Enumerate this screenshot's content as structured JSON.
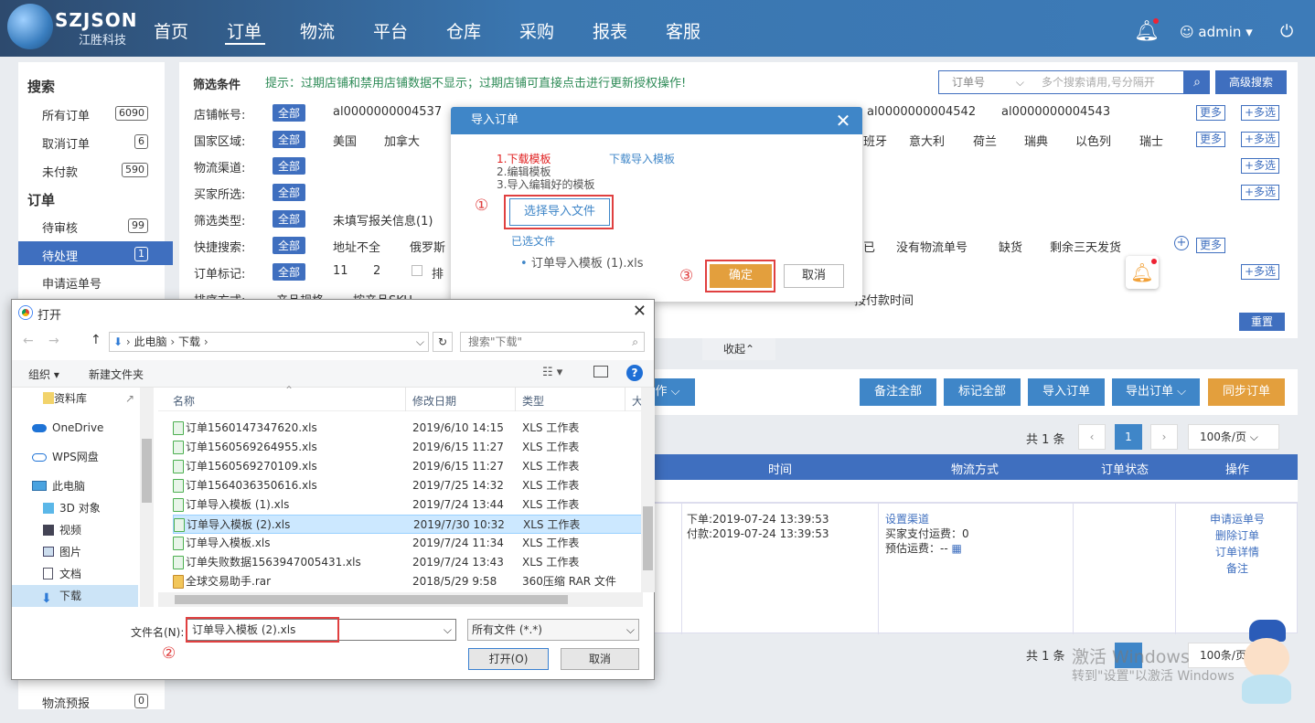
{
  "app": {
    "brand": "SZJSON",
    "brand_sub": "江胜科技",
    "user": "admin"
  },
  "nav": [
    "首页",
    "订单",
    "物流",
    "平台",
    "仓库",
    "采购",
    "报表",
    "客服"
  ],
  "sidebar": {
    "search_header": "搜索",
    "search_items": [
      {
        "label": "所有订单",
        "count": "6090"
      },
      {
        "label": "取消订单",
        "count": "6"
      },
      {
        "label": "未付款",
        "count": "590"
      }
    ],
    "order_header": "订单",
    "order_items": [
      {
        "label": "待审核",
        "count": "99"
      },
      {
        "label": "待处理",
        "count": "1"
      },
      {
        "label": "申请运单号",
        "count": ""
      }
    ],
    "bottom_item": {
      "label": "物流预报",
      "count": "0"
    }
  },
  "filter": {
    "title": "筛选条件",
    "hint": "提示：过期店铺和禁用店铺数据不显示；过期店铺可直接点击进行更新授权操作!",
    "search_select": "订单号",
    "search_placeholder": "多个搜索请用,号分隔开",
    "advanced": "高级搜索",
    "all": "全部",
    "more": "更多",
    "multi": "+多选",
    "rows": [
      {
        "label": "店铺帐号:",
        "values": [
          "al0000000004537",
          "al0000000004542",
          "al0000000004543"
        ]
      },
      {
        "label": "国家区域:",
        "values": [
          "美国",
          "加拿大",
          "班牙",
          "意大利",
          "荷兰",
          "瑞典",
          "以色列",
          "瑞士"
        ]
      },
      {
        "label": "物流渠道:",
        "values": []
      },
      {
        "label": "买家所选:",
        "values": []
      },
      {
        "label": "筛选类型:",
        "values": [
          "未填写报关信息(1)"
        ]
      },
      {
        "label": "快捷搜索:",
        "values": [
          "地址不全",
          "俄罗斯",
          "已",
          "没有物流单号",
          "缺货",
          "剩余三天发货"
        ]
      },
      {
        "label": "订单标记:",
        "values": [
          "11",
          "2",
          "排"
        ]
      },
      {
        "label": "排序方式:",
        "values": [
          "产品规格",
          "按产品SKU",
          "按付款时间"
        ]
      }
    ],
    "reset": "重置",
    "collapse": "收起"
  },
  "actions": [
    "作",
    "备注全部",
    "标记全部",
    "导入订单",
    "导出订单",
    "同步订单"
  ],
  "pager": {
    "total": "共 1 条",
    "page": "1",
    "size": "100条/页"
  },
  "table": {
    "headers": [
      "时间",
      "物流方式",
      "订单状态",
      "操作"
    ],
    "row": {
      "order_time": "下单:2019-07-24 13:39:53",
      "pay_time": "付款:2019-07-24 13:39:53",
      "logistics_link": "设置渠道",
      "buyer_fee": "买家支付运费：0",
      "est_fee": "预估运费：--",
      "ops": [
        "申请运单号",
        "删除订单",
        "订单详情",
        "备注"
      ]
    }
  },
  "watermark": {
    "line1": "激活 Windows",
    "line2": "转到\"设置\"以激活 Windows"
  },
  "import_dialog": {
    "title": "导入订单",
    "step1": "1.下载模板",
    "download_link": "下载导入模板",
    "step2": "2.编辑模板",
    "step3": "3.导入编辑好的模板",
    "choose": "选择导入文件",
    "selected_label": "已选文件",
    "selected_file": "订单导入模板 (1).xls",
    "ok": "确定",
    "cancel": "取消",
    "mark1": "①",
    "mark3": "③"
  },
  "file_dialog": {
    "title": "打开",
    "path": [
      "此电脑",
      "下载"
    ],
    "search_placeholder": "搜索\"下载\"",
    "organize": "组织",
    "new_folder": "新建文件夹",
    "nav": [
      "资料库",
      "OneDrive",
      "WPS网盘",
      "此电脑",
      "3D 对象",
      "视频",
      "图片",
      "文档",
      "下载"
    ],
    "columns": [
      "名称",
      "修改日期",
      "类型",
      "大"
    ],
    "files": [
      {
        "name": "订单1560147347620.xls",
        "date": "2019/6/10 14:15",
        "type": "XLS 工作表"
      },
      {
        "name": "订单1560569264955.xls",
        "date": "2019/6/15 11:27",
        "type": "XLS 工作表"
      },
      {
        "name": "订单1560569270109.xls",
        "date": "2019/6/15 11:27",
        "type": "XLS 工作表"
      },
      {
        "name": "订单1564036350616.xls",
        "date": "2019/7/25 14:32",
        "type": "XLS 工作表"
      },
      {
        "name": "订单导入模板 (1).xls",
        "date": "2019/7/24 13:44",
        "type": "XLS 工作表"
      },
      {
        "name": "订单导入模板 (2).xls",
        "date": "2019/7/30 10:32",
        "type": "XLS 工作表"
      },
      {
        "name": "订单导入模板.xls",
        "date": "2019/7/24 11:34",
        "type": "XLS 工作表"
      },
      {
        "name": "订单失败数据1563947005431.xls",
        "date": "2019/7/24 13:43",
        "type": "XLS 工作表"
      },
      {
        "name": "全球交易助手.rar",
        "date": "2018/5/29 9:58",
        "type": "360压缩 RAR 文件"
      }
    ],
    "selected_index": 5,
    "filename_label": "文件名(N):",
    "filename": "订单导入模板 (2).xls",
    "filetype": "所有文件 (*.*)",
    "open": "打开(O)",
    "cancel": "取消",
    "mark2": "②"
  }
}
